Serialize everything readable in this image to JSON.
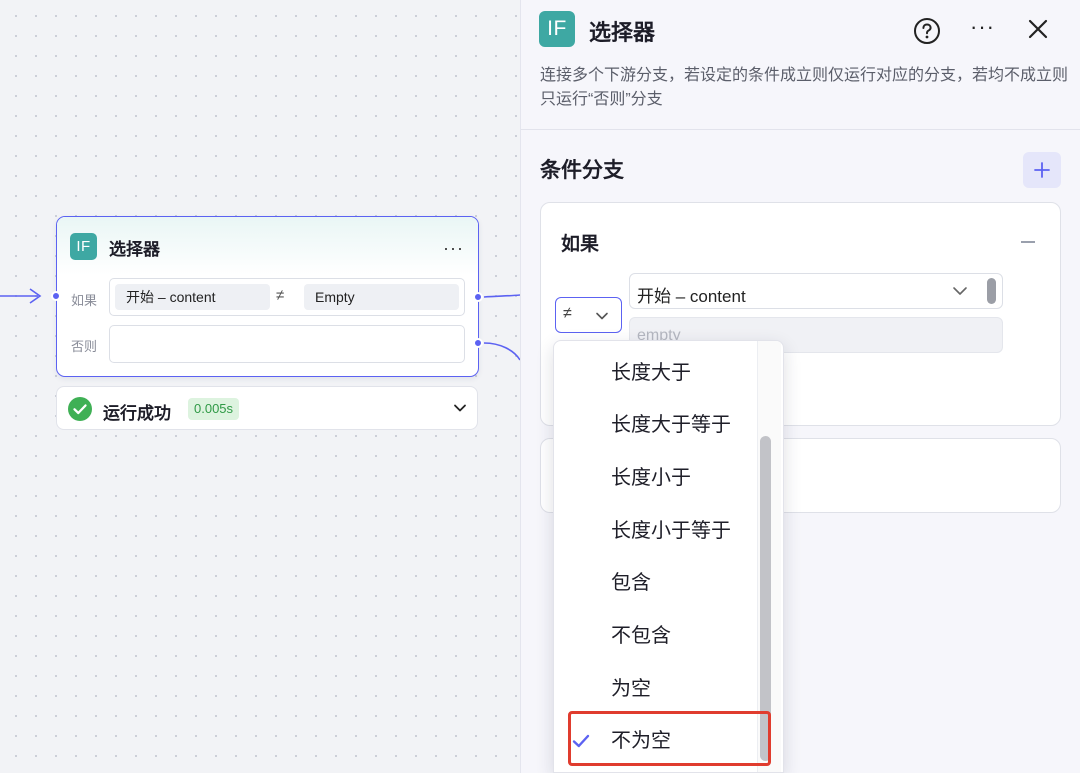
{
  "node": {
    "badge": "IF",
    "title": "选择器",
    "more": "···",
    "if_label": "如果",
    "else_label": "否则",
    "condition": {
      "source": "开始 – content",
      "operator_symbol": "≠",
      "value": "Empty"
    }
  },
  "status": {
    "text": "运行成功",
    "duration": "0.005s"
  },
  "panel": {
    "badge": "IF",
    "title": "选择器",
    "more": "···",
    "description": "连接多个下游分支，若设定的条件成立则仅运行对应的分支，若均不成立则只运行“否则”分支",
    "section_title": "条件分支",
    "branch": {
      "label": "如果",
      "operator_symbol": "≠",
      "variable": "开始 – content",
      "value_placeholder": "empty"
    }
  },
  "dropdown": {
    "items": [
      {
        "label": "长度大于",
        "selected": false
      },
      {
        "label": "长度大于等于",
        "selected": false
      },
      {
        "label": "长度小于",
        "selected": false
      },
      {
        "label": "长度小于等于",
        "selected": false
      },
      {
        "label": "包含",
        "selected": false
      },
      {
        "label": "不包含",
        "selected": false
      },
      {
        "label": "为空",
        "selected": false
      },
      {
        "label": "不为空",
        "selected": true
      }
    ]
  },
  "colors": {
    "accent": "#5c62f2",
    "badge": "#3ea8a3",
    "success": "#2f9a46",
    "highlight": "#e03c2e"
  },
  "icons": {
    "node_badge": "if-icon",
    "help": "question-circle-icon",
    "close": "close-icon",
    "add": "plus-icon",
    "status": "check-circle-icon",
    "selected": "checkmark-icon"
  }
}
